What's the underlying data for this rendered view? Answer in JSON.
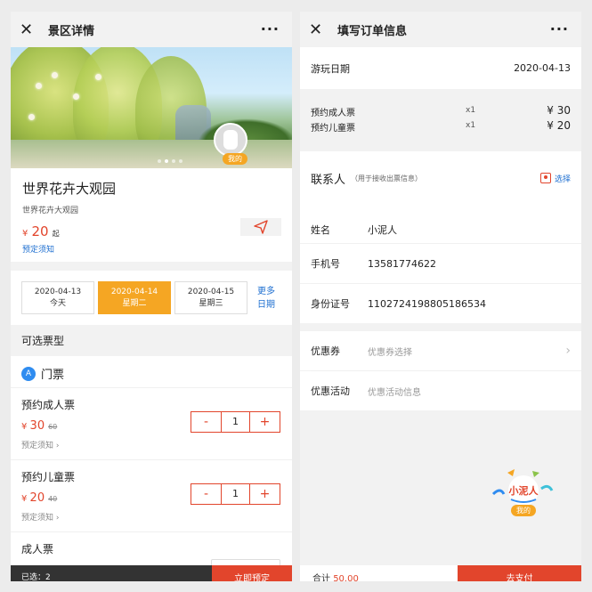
{
  "left": {
    "title": "景区详情",
    "more": "···",
    "wode": "我的",
    "scenic": {
      "name": "世界花卉大观园",
      "subtitle": "世界花卉大观园",
      "price_symbol": "¥",
      "price": "20",
      "price_suffix": "起",
      "notice": "预定须知"
    },
    "dates": [
      {
        "date": "2020-04-13",
        "day": "今天",
        "selected": false
      },
      {
        "date": "2020-04-14",
        "day": "星期二",
        "selected": true
      },
      {
        "date": "2020-04-15",
        "day": "星期三",
        "selected": false
      }
    ],
    "more_dates_line1": "更多",
    "more_dates_line2": "日期",
    "ticket_section_title": "可选票型",
    "ticket_category": "门票",
    "ticket_category_badge": "A",
    "tickets": [
      {
        "name": "预约成人票",
        "price": "30",
        "orig": "60",
        "notice": "预定须知",
        "qty": "1"
      },
      {
        "name": "预约儿童票",
        "price": "20",
        "orig": "40",
        "notice": "预定须知",
        "qty": "1"
      }
    ],
    "last_ticket_name": "成人票",
    "selected_label": "已选：2",
    "book_label": "立即预定"
  },
  "right": {
    "title": "填写订单信息",
    "more": "···",
    "play_date_label": "游玩日期",
    "play_date": "2020-04-13",
    "order_tickets": [
      {
        "name": "预约成人票",
        "qty": "x1",
        "price": "¥  30"
      },
      {
        "name": "预约儿童票",
        "qty": "x1",
        "price": "¥  20"
      }
    ],
    "contact_title": "联系人",
    "contact_sub": "（用于接收出票信息）",
    "choose_label": "选择",
    "fields": [
      {
        "label": "姓名",
        "value": "小泥人"
      },
      {
        "label": "手机号",
        "value": "13581774622"
      },
      {
        "label": "身份证号",
        "value": "110272419880518653­4"
      }
    ],
    "coupon_label": "优惠券",
    "coupon_placeholder": "优惠券选择",
    "promo_label": "优惠活动",
    "promo_placeholder": "优惠活动信息",
    "mascot_text": "小泥人",
    "wode": "我的",
    "total_label": "合计",
    "total_amount": "50.00",
    "pay_label": "去支付"
  },
  "colors": {
    "accent_red": "#e2452c",
    "accent_orange": "#f5a623",
    "link_blue": "#1e6fd0"
  }
}
